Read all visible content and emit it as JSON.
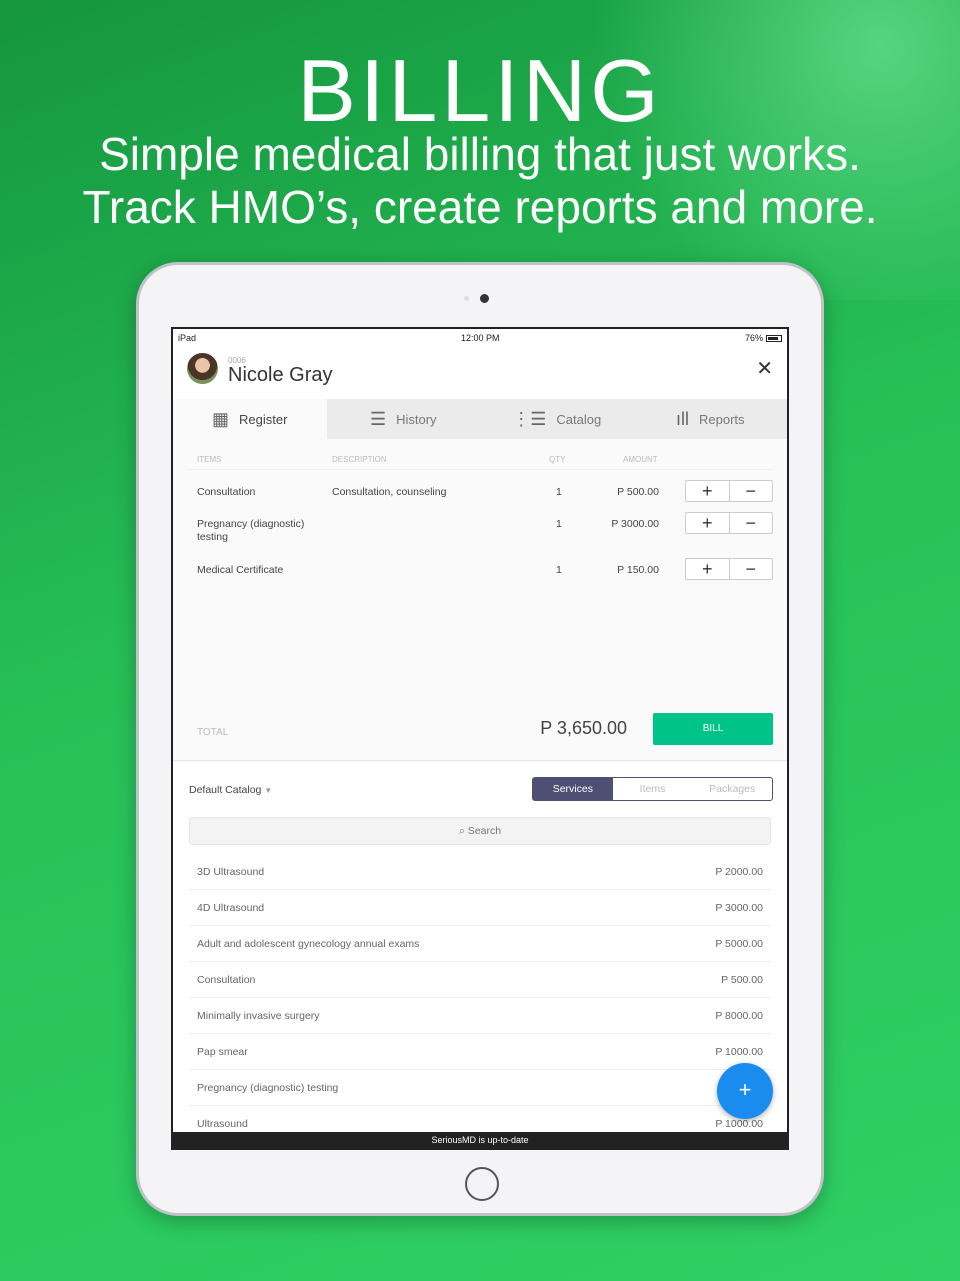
{
  "hero": {
    "title": "BILLING",
    "line1": "Simple medical billing that just works.",
    "line2": "Track HMO’s, create reports and more."
  },
  "status": {
    "device": "iPad",
    "time": "12:00 PM",
    "battery": "76%"
  },
  "patient": {
    "id": "0006",
    "name": "Nicole Gray"
  },
  "tabs": [
    {
      "label": "Register",
      "icon": "calculator-icon"
    },
    {
      "label": "History",
      "icon": "history-icon"
    },
    {
      "label": "Catalog",
      "icon": "list-icon"
    },
    {
      "label": "Reports",
      "icon": "bar-chart-icon"
    }
  ],
  "items": {
    "headers": {
      "items": "ITEMS",
      "description": "DESCRIPTION",
      "qty": "QTY",
      "amount": "AMOUNT"
    },
    "rows": [
      {
        "item": "Consultation",
        "description": "Consultation, counseling",
        "qty": "1",
        "amount": "P 500.00"
      },
      {
        "item": "Pregnancy (diagnostic) testing",
        "description": "",
        "qty": "1",
        "amount": "P 3000.00"
      },
      {
        "item": "Medical Certificate",
        "description": "",
        "qty": "1",
        "amount": "P 150.00"
      }
    ]
  },
  "total": {
    "label": "TOTAL",
    "value": "P 3,650.00",
    "bill": "BILL"
  },
  "catalog": {
    "selector": "Default Catalog",
    "segments": [
      "Services",
      "Items",
      "Packages"
    ],
    "active_segment": "Services",
    "search_placeholder": "Search",
    "services": [
      {
        "name": "3D Ultrasound",
        "price": "P 2000.00"
      },
      {
        "name": "4D Ultrasound",
        "price": "P 3000.00"
      },
      {
        "name": "Adult and adolescent gynecology annual exams",
        "price": "P 5000.00"
      },
      {
        "name": "Consultation",
        "price": "P 500.00"
      },
      {
        "name": "Minimally invasive surgery",
        "price": "P 8000.00"
      },
      {
        "name": "Pap smear",
        "price": "P 1000.00"
      },
      {
        "name": "Pregnancy (diagnostic) testing",
        "price": ""
      },
      {
        "name": "Ultrasound",
        "price": "P 1000.00"
      }
    ]
  },
  "fab": "+",
  "footer": "SeriousMD is up-to-date",
  "colors": {
    "accent": "#00c389",
    "segment": "#4f4f73",
    "fab": "#1a8cf0"
  }
}
